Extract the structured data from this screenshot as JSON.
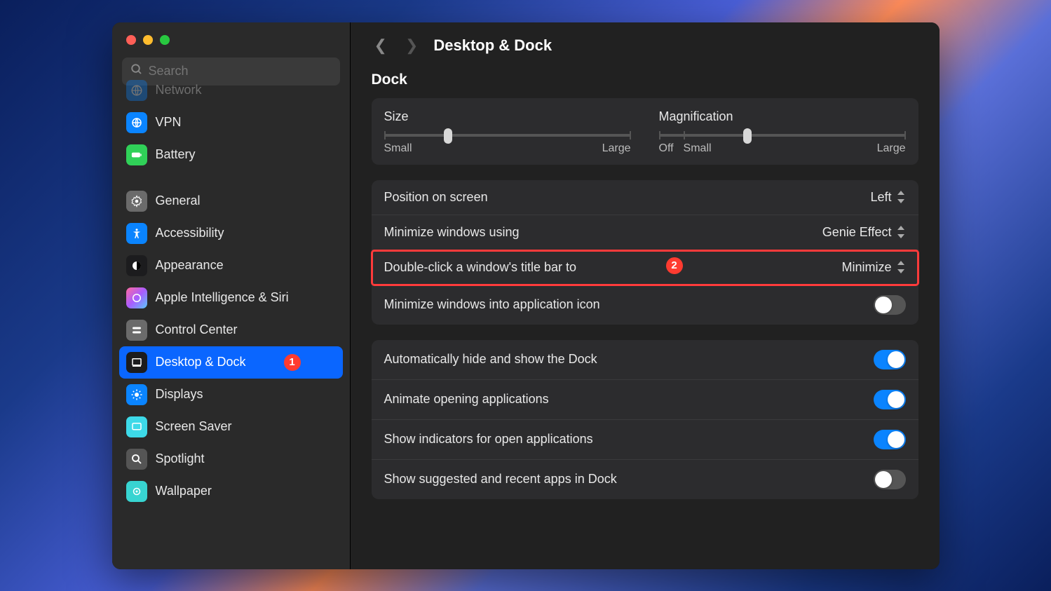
{
  "search": {
    "placeholder": "Search"
  },
  "header": {
    "title": "Desktop & Dock"
  },
  "sidebar": {
    "items": [
      {
        "label": "Network"
      },
      {
        "label": "VPN"
      },
      {
        "label": "Battery"
      },
      {
        "label": "General"
      },
      {
        "label": "Accessibility"
      },
      {
        "label": "Appearance"
      },
      {
        "label": "Apple Intelligence & Siri"
      },
      {
        "label": "Control Center"
      },
      {
        "label": "Desktop & Dock"
      },
      {
        "label": "Displays"
      },
      {
        "label": "Screen Saver"
      },
      {
        "label": "Spotlight"
      },
      {
        "label": "Wallpaper"
      }
    ]
  },
  "annotations": {
    "one": "1",
    "two": "2"
  },
  "dock": {
    "section_title": "Dock",
    "size": {
      "label": "Size",
      "min": "Small",
      "max": "Large",
      "value_pct": 26
    },
    "magnification": {
      "label": "Magnification",
      "off": "Off",
      "min": "Small",
      "max": "Large",
      "value_pct": 36
    },
    "rows": {
      "position": {
        "label": "Position on screen",
        "value": "Left"
      },
      "minimize_using": {
        "label": "Minimize windows using",
        "value": "Genie Effect"
      },
      "double_click": {
        "label": "Double-click a window's title bar to",
        "value": "Minimize"
      },
      "minimize_into": {
        "label": "Minimize windows into application icon",
        "on": false
      },
      "autohide": {
        "label": "Automatically hide and show the Dock",
        "on": true
      },
      "animate": {
        "label": "Animate opening applications",
        "on": true
      },
      "indicators": {
        "label": "Show indicators for open applications",
        "on": true
      },
      "suggested": {
        "label": "Show suggested and recent apps in Dock",
        "on": false
      }
    }
  }
}
